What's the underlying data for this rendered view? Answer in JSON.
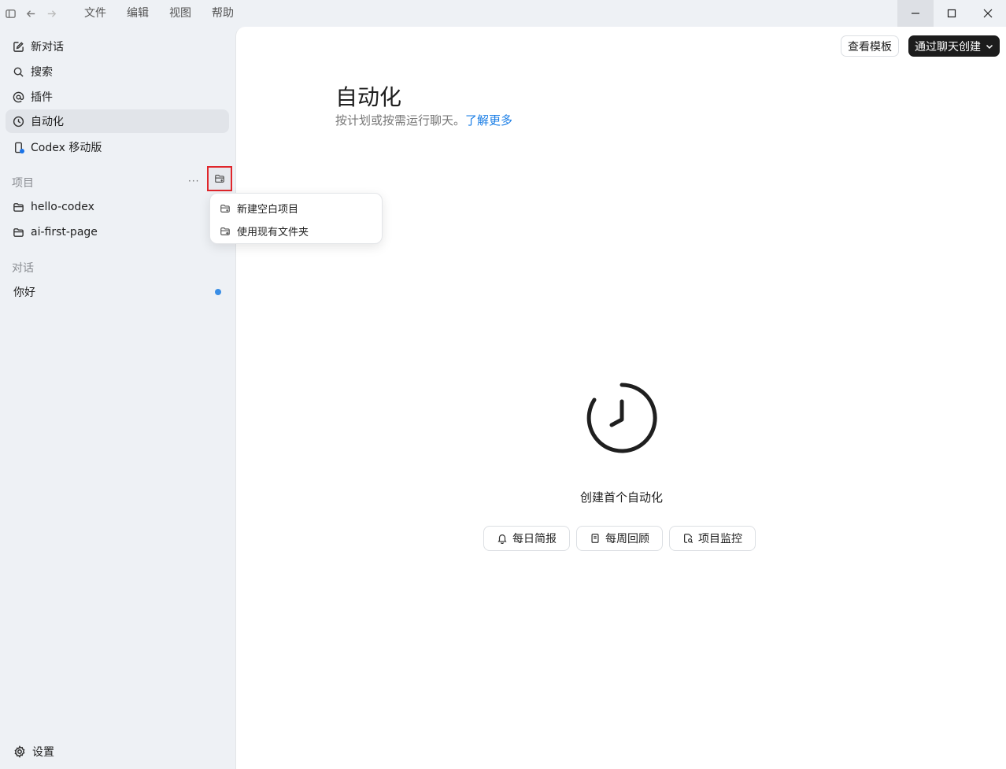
{
  "titlebar": {
    "menu": [
      "文件",
      "编辑",
      "视图",
      "帮助"
    ]
  },
  "sidebar": {
    "nav": [
      {
        "label": "新对话",
        "icon": "edit-icon"
      },
      {
        "label": "搜索",
        "icon": "search-icon"
      },
      {
        "label": "插件",
        "icon": "at-icon"
      },
      {
        "label": "自动化",
        "icon": "clock-icon",
        "active": true
      },
      {
        "label": "Codex 移动版",
        "icon": "mobile-icon"
      }
    ],
    "projects_label": "项目",
    "projects": [
      "hello-codex",
      "ai-first-page"
    ],
    "chats_label": "对话",
    "chats": [
      "你好"
    ],
    "settings_label": "设置"
  },
  "dropdown": {
    "items": [
      "新建空白项目",
      "使用现有文件夹"
    ]
  },
  "main": {
    "templates_button": "查看模板",
    "create_button": "通过聊天创建",
    "title": "自动化",
    "subtitle": "按计划或按需运行聊天。",
    "learn_more": "了解更多",
    "empty_title": "创建首个自动化",
    "chips": [
      "每日简报",
      "每周回顾",
      "项目监控"
    ]
  },
  "colors": {
    "accent_link": "#1a7ee6",
    "unread_dot": "#3a8ee6",
    "highlight_border": "#e0262b"
  }
}
